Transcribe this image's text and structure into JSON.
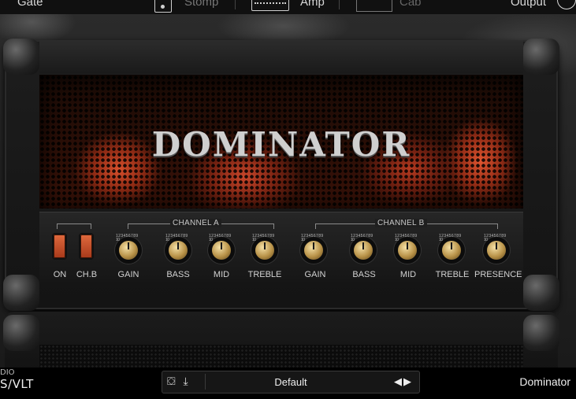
{
  "nav": {
    "gate": "Gate",
    "stomp": "Stomp",
    "amp": "Amp",
    "cab": "Cab",
    "output": "Output"
  },
  "amp": {
    "logo": "DOMINATOR",
    "switches": {
      "on": "ON",
      "chb": "CH.B"
    },
    "channel_a": {
      "title": "CHANNEL A",
      "controls": [
        "GAIN",
        "BASS",
        "MID",
        "TREBLE"
      ]
    },
    "channel_b": {
      "title": "CHANNEL B",
      "controls": [
        "GAIN",
        "BASS",
        "MID",
        "TREBLE",
        "PRESENCE"
      ]
    },
    "knob_scale": "1 2 3 4 5 6 7 8 9 10"
  },
  "footer": {
    "brand_line1": "DIO",
    "brand_line2": "S/VLT",
    "preset_name": "Default",
    "plugin_name": "Dominator"
  },
  "icons": [
    "stomp-icon",
    "amp-icon",
    "cab-icon",
    "output-icon",
    "preset-browser-icon",
    "save-icon",
    "prev-arrow-icon",
    "next-arrow-icon"
  ],
  "colors": {
    "switch": "#c24a22",
    "knob": "#c9a55a",
    "glow": "#d8502c"
  }
}
